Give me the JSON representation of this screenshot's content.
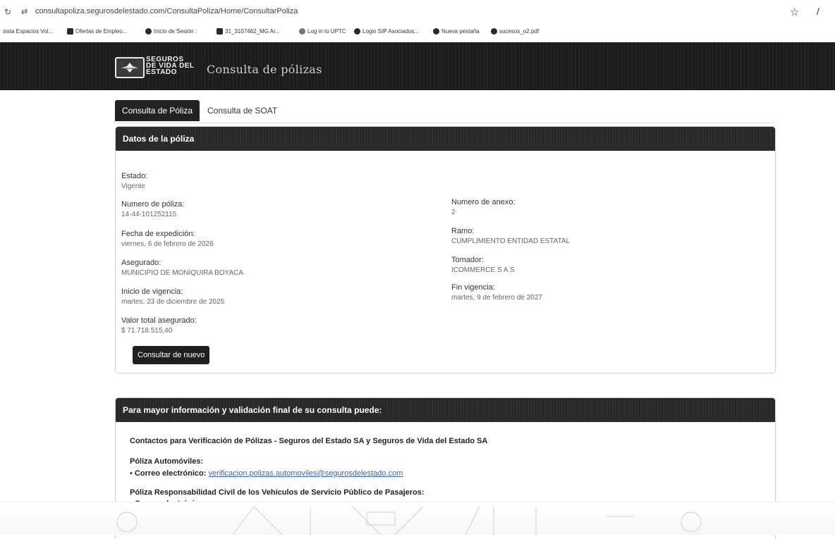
{
  "browser": {
    "url": "consultapoliza.segurosdelestado.com/ConsultaPoliza/Home/ConsultarPoliza",
    "bookmarks": [
      "sista Espacios Vol...",
      "Ofertas de Empleo...",
      "Inicio de Sesión :",
      "31_3107462_MG Ar...",
      "Log in to UPTC",
      "Login SIP Asociados...",
      "Nueva pestaña",
      "sucesos_o2.pdf"
    ]
  },
  "header": {
    "logo_lines": [
      "SEGUROS",
      "DE VIDA DEL",
      "ESTADO"
    ],
    "title": "Consulta de pólizas"
  },
  "tabs": {
    "active": "Consulta de Póliza",
    "inactive": "Consulta de SOAT"
  },
  "datos": {
    "title": "Datos de la póliza",
    "estado_label": "Estado:",
    "estado_value": "Vigente",
    "numero_label": "Numero de póliza:",
    "numero_value": "14-44-101252115",
    "expedicion_label": "Fecha de expedición:",
    "expedicion_value": "viernes, 6 de febrero de 2026",
    "asegurado_label": "Asegurado:",
    "asegurado_value": "MUNICIPIO DE MONIQUIRA BOYACA",
    "inicio_label": "Inicio de vigencia:",
    "inicio_value": "martes, 23 de diciembre de 2025",
    "valor_label": "Valor total asegurado:",
    "valor_value": "$ 71.718.515,40",
    "anexo_label": "Numero de anexo:",
    "anexo_value": "2",
    "ramo_label": "Ramo:",
    "ramo_value": "CUMPLIMIENTO ENTIDAD ESTATAL",
    "tomador_label": "Tomador:",
    "tomador_value": "ICOMMERCE S A S",
    "fin_label": "Fin vigencia:",
    "fin_value": "martes, 9 de febrero de 2027",
    "button": "Consultar de nuevo"
  },
  "info": {
    "title": "Para mayor información y validación final de su consulta puede:",
    "contacts_heading": "Contactos para Verificación de Pólizas - Seguros del Estado SA y Seguros de Vida del Estado SA",
    "auto_heading": "Póliza Automóviles:",
    "email_label": "Correo electrónico:",
    "auto_email": "verificacion.polizas.automoviles@segurosdelestado.com",
    "rc_heading": "Póliza Responsabilidad Civil de los Vehículos de Servicio Público de Pasajeros:"
  }
}
